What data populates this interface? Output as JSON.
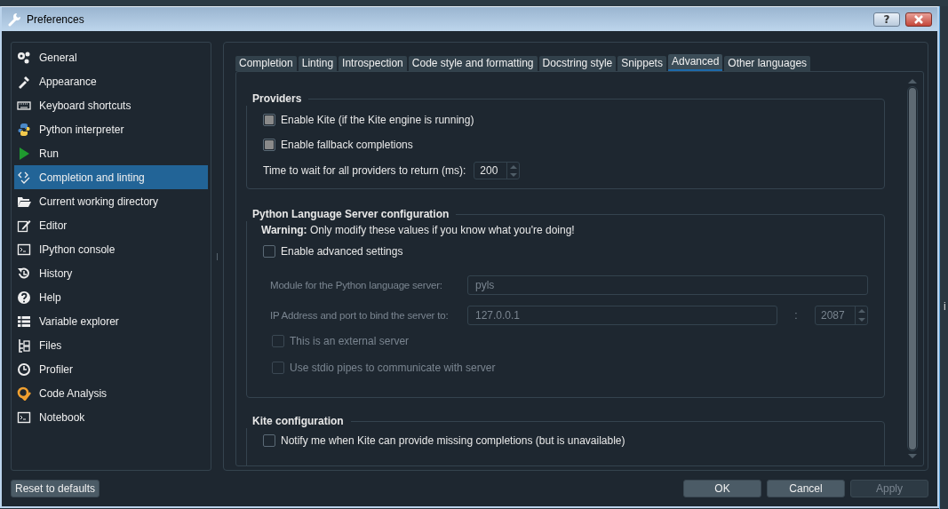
{
  "window": {
    "title": "Preferences",
    "help": "?"
  },
  "sidebar": {
    "items": [
      {
        "label": "General",
        "selected": false
      },
      {
        "label": "Appearance",
        "selected": false
      },
      {
        "label": "Keyboard shortcuts",
        "selected": false
      },
      {
        "label": "Python interpreter",
        "selected": false
      },
      {
        "label": "Run",
        "selected": false
      },
      {
        "label": "Completion and linting",
        "selected": true
      },
      {
        "label": "Current working directory",
        "selected": false
      },
      {
        "label": "Editor",
        "selected": false
      },
      {
        "label": "IPython console",
        "selected": false
      },
      {
        "label": "History",
        "selected": false
      },
      {
        "label": "Help",
        "selected": false
      },
      {
        "label": "Variable explorer",
        "selected": false
      },
      {
        "label": "Files",
        "selected": false
      },
      {
        "label": "Profiler",
        "selected": false
      },
      {
        "label": "Code Analysis",
        "selected": false
      },
      {
        "label": "Notebook",
        "selected": false
      }
    ]
  },
  "tabs": [
    {
      "label": "Completion",
      "selected": false
    },
    {
      "label": "Linting",
      "selected": false
    },
    {
      "label": "Introspection",
      "selected": false
    },
    {
      "label": "Code style and formatting",
      "selected": false
    },
    {
      "label": "Docstring style",
      "selected": false
    },
    {
      "label": "Snippets",
      "selected": false
    },
    {
      "label": "Advanced",
      "selected": true
    },
    {
      "label": "Other languages",
      "selected": false
    }
  ],
  "providers": {
    "title": "Providers",
    "options": [
      {
        "label": "Enable Kite (if the Kite engine is running)",
        "checked": true
      },
      {
        "label": "Enable fallback completions",
        "checked": true
      }
    ],
    "wait": {
      "label": "Time to wait for all providers to return (ms):",
      "value": "200"
    }
  },
  "lsp": {
    "title": "Python Language Server configuration",
    "warning": "**Warning:** Only modify these values if you know what you're doing!",
    "advanced": {
      "label": "Enable advanced settings",
      "checked": false
    },
    "module": {
      "label": "Module for the Python language server:",
      "value": "pyls",
      "disabled": true
    },
    "address": {
      "label": "IP Address and port to bind the server to:",
      "value": "127.0.0.1",
      "separator": ":",
      "port": "2087",
      "disabled": true
    },
    "options": [
      {
        "label": "This is an external server",
        "checked": false,
        "disabled": true
      },
      {
        "label": "Use stdio pipes to communicate with server",
        "checked": false,
        "disabled": true
      }
    ]
  },
  "kite": {
    "title": "Kite configuration",
    "options": [
      {
        "label": "Notify me when Kite can provide missing completions (but is unavailable)",
        "checked": false
      }
    ]
  },
  "footer": {
    "reset": "Reset to defaults",
    "buttons": [
      {
        "label": "OK",
        "disabled": false
      },
      {
        "label": "Cancel",
        "disabled": false
      },
      {
        "label": "Apply",
        "disabled": true
      }
    ]
  },
  "editor_fragment": "i"
}
